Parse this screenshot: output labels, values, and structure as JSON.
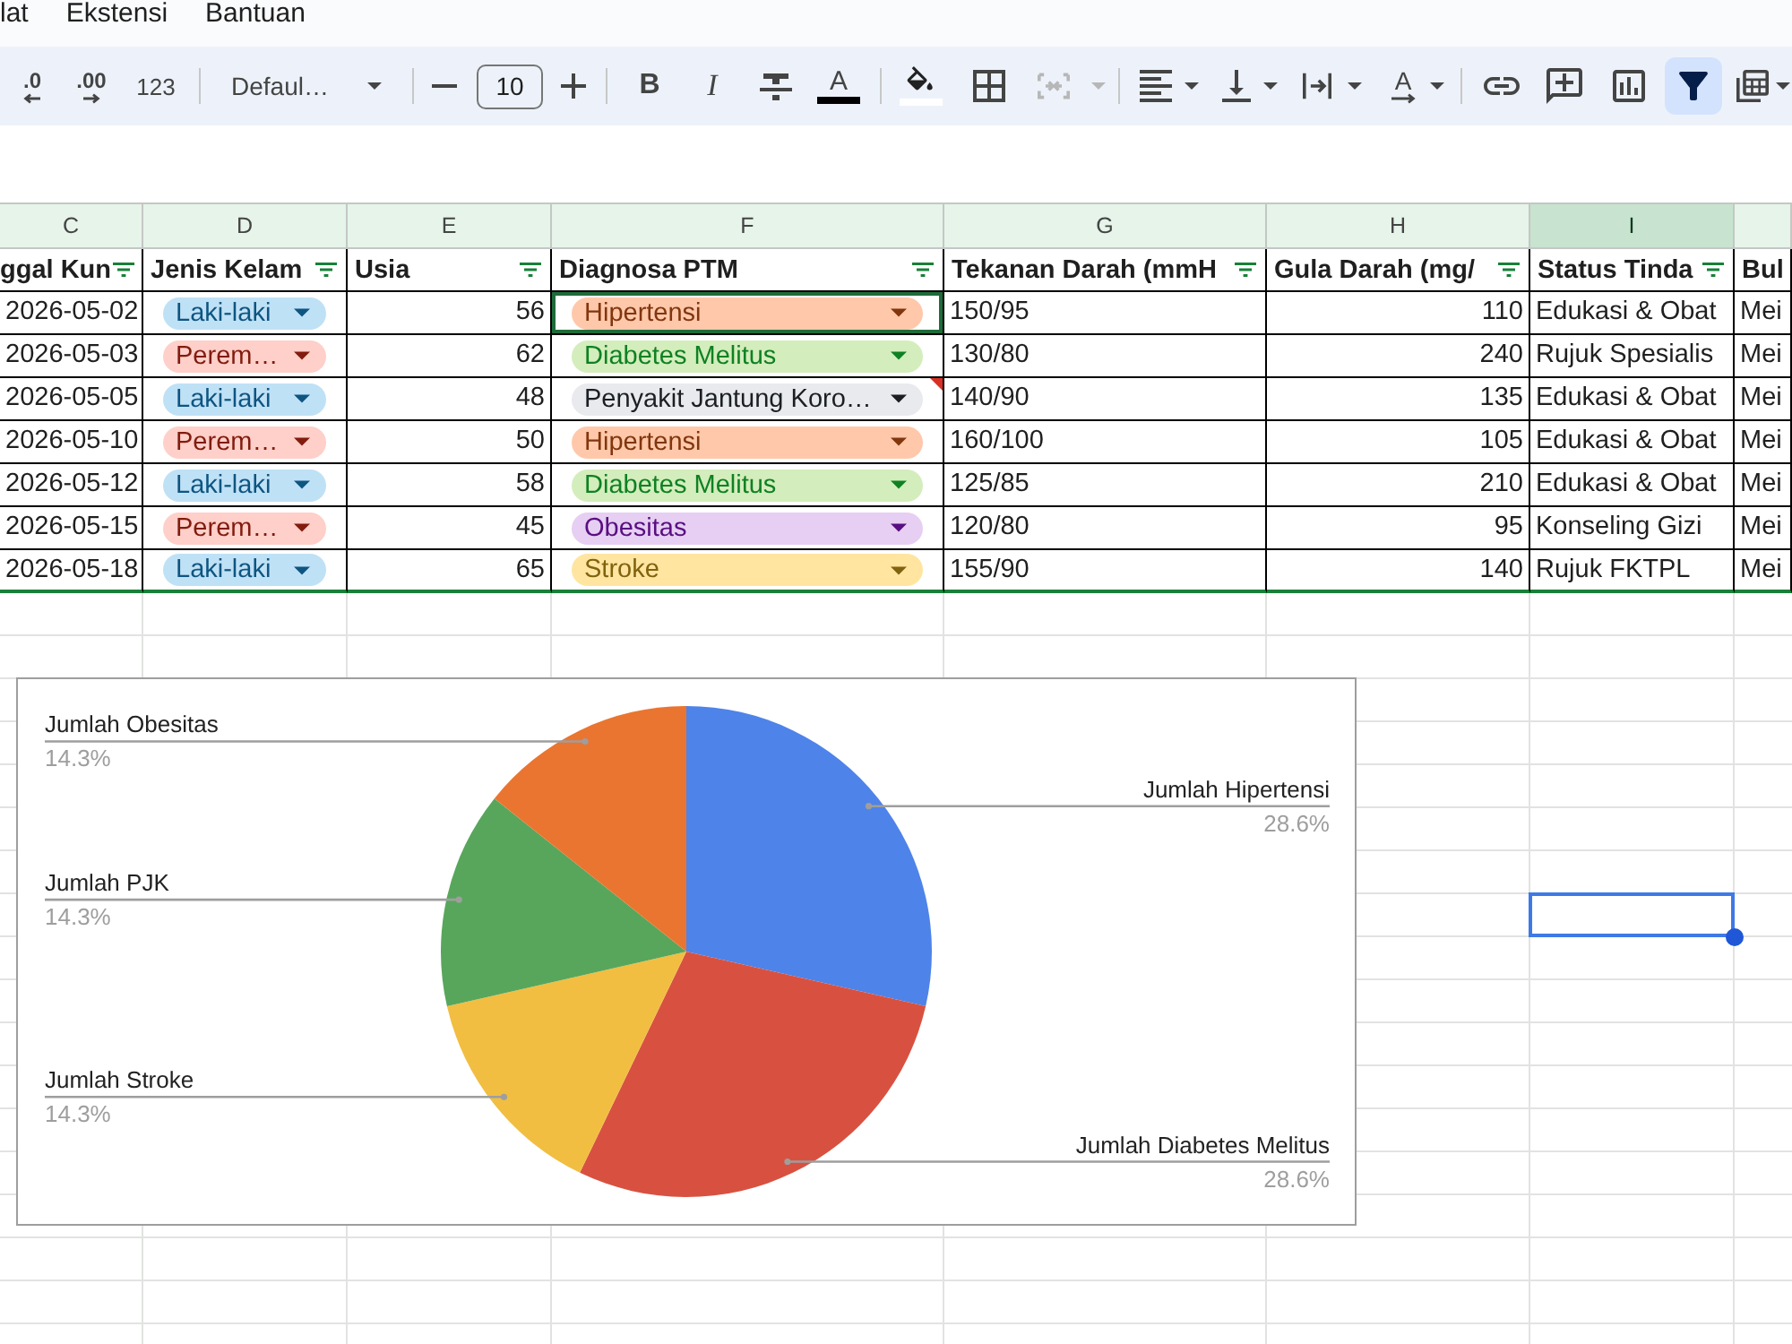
{
  "menu": [
    {
      "label": "lat"
    },
    {
      "label": "Ekstensi"
    },
    {
      "label": "Bantuan"
    }
  ],
  "toolbar": {
    "decrease_decimal": ".0",
    "increase_decimal": ".00",
    "number_format": "123",
    "font": "Defaul…",
    "font_size": "10",
    "bold": "B",
    "italic": "I",
    "text_color": "A",
    "text_rotation": "A",
    "merge_disabled": true,
    "filter_active": true
  },
  "sheet": {
    "columns": [
      {
        "letter": "C",
        "header": "ggal Kun",
        "kind": "number",
        "filter": true,
        "selected": false
      },
      {
        "letter": "D",
        "header": "Jenis Kelam",
        "kind": "chip",
        "filter": true,
        "selected": false
      },
      {
        "letter": "E",
        "header": "Usia",
        "kind": "number",
        "filter": true,
        "selected": false
      },
      {
        "letter": "F",
        "header": "Diagnosa PTM",
        "kind": "chip",
        "filter": true,
        "selected": false
      },
      {
        "letter": "G",
        "header": "Tekanan Darah (mmH",
        "kind": "text",
        "filter": true,
        "selected": false
      },
      {
        "letter": "H",
        "header": "Gula Darah (mg/",
        "kind": "number",
        "filter": true,
        "selected": false
      },
      {
        "letter": "I",
        "header": "Status Tinda",
        "kind": "text",
        "filter": true,
        "selected": true
      },
      {
        "header": "Bul",
        "kind": "text",
        "filter": false,
        "selected": false
      }
    ],
    "rows": [
      {
        "cells": [
          "2026-05-02",
          {
            "label": "Laki-laki",
            "color": "#bfe1f6",
            "highlighted": false,
            "invalid": false
          },
          "56",
          {
            "label": "Hipertensi",
            "color": "#ffc8aa",
            "highlighted": true,
            "invalid": false
          },
          "150/95",
          "110",
          "Edukasi & Obat",
          "Mei"
        ]
      },
      {
        "cells": [
          "2026-05-03",
          {
            "label": "Perem…",
            "color": "#ffcfc9",
            "highlighted": false,
            "invalid": false
          },
          "62",
          {
            "label": "Diabetes Melitus",
            "color": "#d4edbc",
            "highlighted": false,
            "invalid": false
          },
          "130/80",
          "240",
          "Rujuk Spesialis",
          "Mei"
        ]
      },
      {
        "cells": [
          "2026-05-05",
          {
            "label": "Laki-laki",
            "color": "#bfe1f6",
            "highlighted": false,
            "invalid": false
          },
          "48",
          {
            "label": "Penyakit Jantung Koro…",
            "color": "#e8eaed",
            "highlighted": false,
            "invalid": true
          },
          "140/90",
          "135",
          "Edukasi & Obat",
          "Mei"
        ]
      },
      {
        "cells": [
          "2026-05-10",
          {
            "label": "Perem…",
            "color": "#ffcfc9",
            "highlighted": false,
            "invalid": false
          },
          "50",
          {
            "label": "Hipertensi",
            "color": "#ffc8aa",
            "highlighted": false,
            "invalid": false
          },
          "160/100",
          "105",
          "Edukasi & Obat",
          "Mei"
        ]
      },
      {
        "cells": [
          "2026-05-12",
          {
            "label": "Laki-laki",
            "color": "#bfe1f6",
            "highlighted": false,
            "invalid": false
          },
          "58",
          {
            "label": "Diabetes Melitus",
            "color": "#d4edbc",
            "highlighted": false,
            "invalid": false
          },
          "125/85",
          "210",
          "Edukasi & Obat",
          "Mei"
        ]
      },
      {
        "cells": [
          "2026-05-15",
          {
            "label": "Perem…",
            "color": "#ffcfc9",
            "highlighted": false,
            "invalid": false
          },
          "45",
          {
            "label": "Obesitas",
            "color": "#e6cff2",
            "highlighted": false,
            "invalid": false
          },
          "120/80",
          "95",
          "Konseling Gizi",
          "Mei"
        ]
      },
      {
        "cells": [
          "2026-05-18",
          {
            "label": "Laki-laki",
            "color": "#bfe1f6",
            "highlighted": false,
            "invalid": false
          },
          "65",
          {
            "label": "Stroke",
            "color": "#ffe5a0",
            "highlighted": false,
            "invalid": false
          },
          "155/90",
          "140",
          "Rujuk FKTPL",
          "Mei"
        ]
      }
    ],
    "empty_rows": [
      {
        "selected": false
      },
      {
        "selected": false
      },
      {
        "selected": false
      },
      {
        "selected": false
      },
      {
        "selected": false
      },
      {
        "selected": false
      },
      {
        "selected": false
      },
      {
        "selected": true
      },
      {
        "selected": false
      },
      {
        "selected": false
      },
      {
        "selected": false
      },
      {
        "selected": false
      },
      {
        "selected": false
      },
      {
        "selected": false
      },
      {
        "selected": false
      },
      {
        "selected": false
      },
      {
        "selected": false
      },
      {
        "selected": false
      }
    ]
  },
  "chart": {
    "chart_data": {
      "type": "pie",
      "categories": [
        "Jumlah Hipertensi",
        "Jumlah Diabetes Melitus",
        "Jumlah Stroke",
        "Jumlah PJK",
        "Jumlah Obesitas"
      ],
      "values": [
        28.6,
        28.6,
        14.3,
        14.3,
        14.3
      ],
      "value_labels": [
        "28.6%",
        "28.6%",
        "14.3%",
        "14.3%",
        "14.3%"
      ],
      "colors": [
        "#4e83e9",
        "#d85140",
        "#f1be42",
        "#58a65c",
        "#ea7530"
      ]
    }
  }
}
